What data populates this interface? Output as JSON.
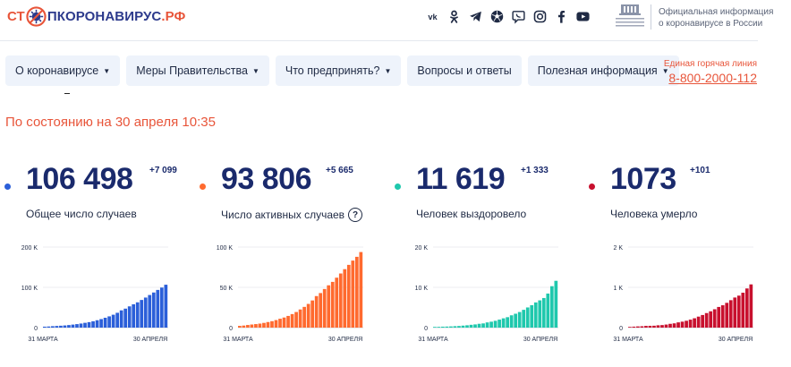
{
  "logo": {
    "prefix": "СТ",
    "middle": "ПКОРОНАВИРУС",
    "suffix": ".РФ"
  },
  "social_icons": [
    "vk-icon",
    "odnoklassniki-icon",
    "telegram-icon",
    "soccer-icon",
    "viber-icon",
    "instagram-icon",
    "facebook-icon",
    "youtube-icon"
  ],
  "gov": {
    "line1": "Официальная информация",
    "line2": "о коронавирусе в России"
  },
  "nav": [
    {
      "label": "О коронавирусе",
      "dropdown": true
    },
    {
      "label": "Меры Правительства",
      "dropdown": true
    },
    {
      "label": "Что предпринять?",
      "dropdown": true
    },
    {
      "label": "Вопросы и ответы",
      "dropdown": false
    },
    {
      "label": "Полезная информация",
      "dropdown": true
    }
  ],
  "hotline": {
    "label": "Единая горячая линия",
    "phone": "8-800-2000-112"
  },
  "status": "По состоянию на 30 апреля 10:35",
  "colors": {
    "accent": "#e8553a",
    "navy": "#1a2a6c",
    "nav_bg": "#eef3fb",
    "blue": "#2b5fd9",
    "orange": "#ff6a2f",
    "teal": "#1fc8ad",
    "red": "#c8102e"
  },
  "stats": [
    {
      "value": "106 498",
      "delta": "+7 099",
      "label": "Общее число случаев",
      "color": "#2b5fd9",
      "help": false
    },
    {
      "value": "93 806",
      "delta": "+5 665",
      "label": "Число активных случаев",
      "color": "#ff6a2f",
      "help": true
    },
    {
      "value": "11 619",
      "delta": "+1 333",
      "label": "Человек выздоровело",
      "color": "#1fc8ad",
      "help": false
    },
    {
      "value": "1073",
      "delta": "+101",
      "label": "Человека умерло",
      "color": "#c8102e",
      "help": false
    }
  ],
  "chart_data": [
    {
      "type": "bar",
      "title": "",
      "xlabel": "",
      "ylabel": "",
      "ylim": [
        0,
        200000
      ],
      "yticks": [
        0,
        100000,
        200000
      ],
      "ytick_labels": [
        "0",
        "100 K",
        "200 K"
      ],
      "x_start_label": "31 МАРТА",
      "x_end_label": "30 АПРЕЛЯ",
      "color": "#2b5fd9",
      "values": [
        2337,
        2777,
        3548,
        4149,
        4731,
        5389,
        6343,
        7497,
        8672,
        10131,
        11917,
        13584,
        15770,
        18328,
        21102,
        24490,
        27938,
        32008,
        36793,
        42853,
        47121,
        52763,
        57999,
        62773,
        68622,
        74588,
        80949,
        87147,
        93558,
        99399,
        106498
      ]
    },
    {
      "type": "bar",
      "title": "",
      "xlabel": "",
      "ylabel": "",
      "ylim": [
        0,
        100000
      ],
      "yticks": [
        0,
        50000,
        100000
      ],
      "ytick_labels": [
        "0",
        "50 K",
        "100 K"
      ],
      "x_start_label": "31 МАРТА",
      "x_end_label": "30 АПРЕЛЯ",
      "color": "#ff6a2f",
      "values": [
        2163,
        2555,
        3277,
        3851,
        4373,
        4978,
        5860,
        6913,
        7986,
        9358,
        11011,
        12522,
        14511,
        16804,
        19375,
        22530,
        25738,
        29437,
        33725,
        39157,
        42887,
        47934,
        52537,
        56778,
        61981,
        67187,
        72567,
        77901,
        83209,
        87888,
        93806
      ]
    },
    {
      "type": "bar",
      "title": "",
      "xlabel": "",
      "ylabel": "",
      "ylim": [
        0,
        20000
      ],
      "yticks": [
        0,
        10000,
        20000
      ],
      "ytick_labels": [
        "0",
        "10 K",
        "20 K"
      ],
      "x_start_label": "31 МАРТА",
      "x_end_label": "30 АПРЕЛЯ",
      "color": "#1fc8ad",
      "values": [
        121,
        190,
        235,
        260,
        300,
        355,
        406,
        494,
        580,
        698,
        795,
        948,
        1045,
        1291,
        1470,
        1694,
        1986,
        2304,
        2590,
        3057,
        3446,
        3873,
        4420,
        5007,
        5568,
        6250,
        6767,
        7346,
        8456,
        10286,
        11619
      ]
    },
    {
      "type": "bar",
      "title": "",
      "xlabel": "",
      "ylabel": "",
      "ylim": [
        0,
        2000
      ],
      "yticks": [
        0,
        1000,
        2000
      ],
      "ytick_labels": [
        "0",
        "1 K",
        "2 K"
      ],
      "x_start_label": "31 МАРТА",
      "x_end_label": "30 АПРЕЛЯ",
      "color": "#c8102e",
      "values": [
        17,
        24,
        30,
        34,
        43,
        45,
        47,
        58,
        63,
        76,
        94,
        106,
        130,
        148,
        170,
        198,
        232,
        273,
        313,
        361,
        405,
        456,
        513,
        555,
        615,
        681,
        747,
        794,
        867,
        972,
        1073
      ]
    }
  ]
}
